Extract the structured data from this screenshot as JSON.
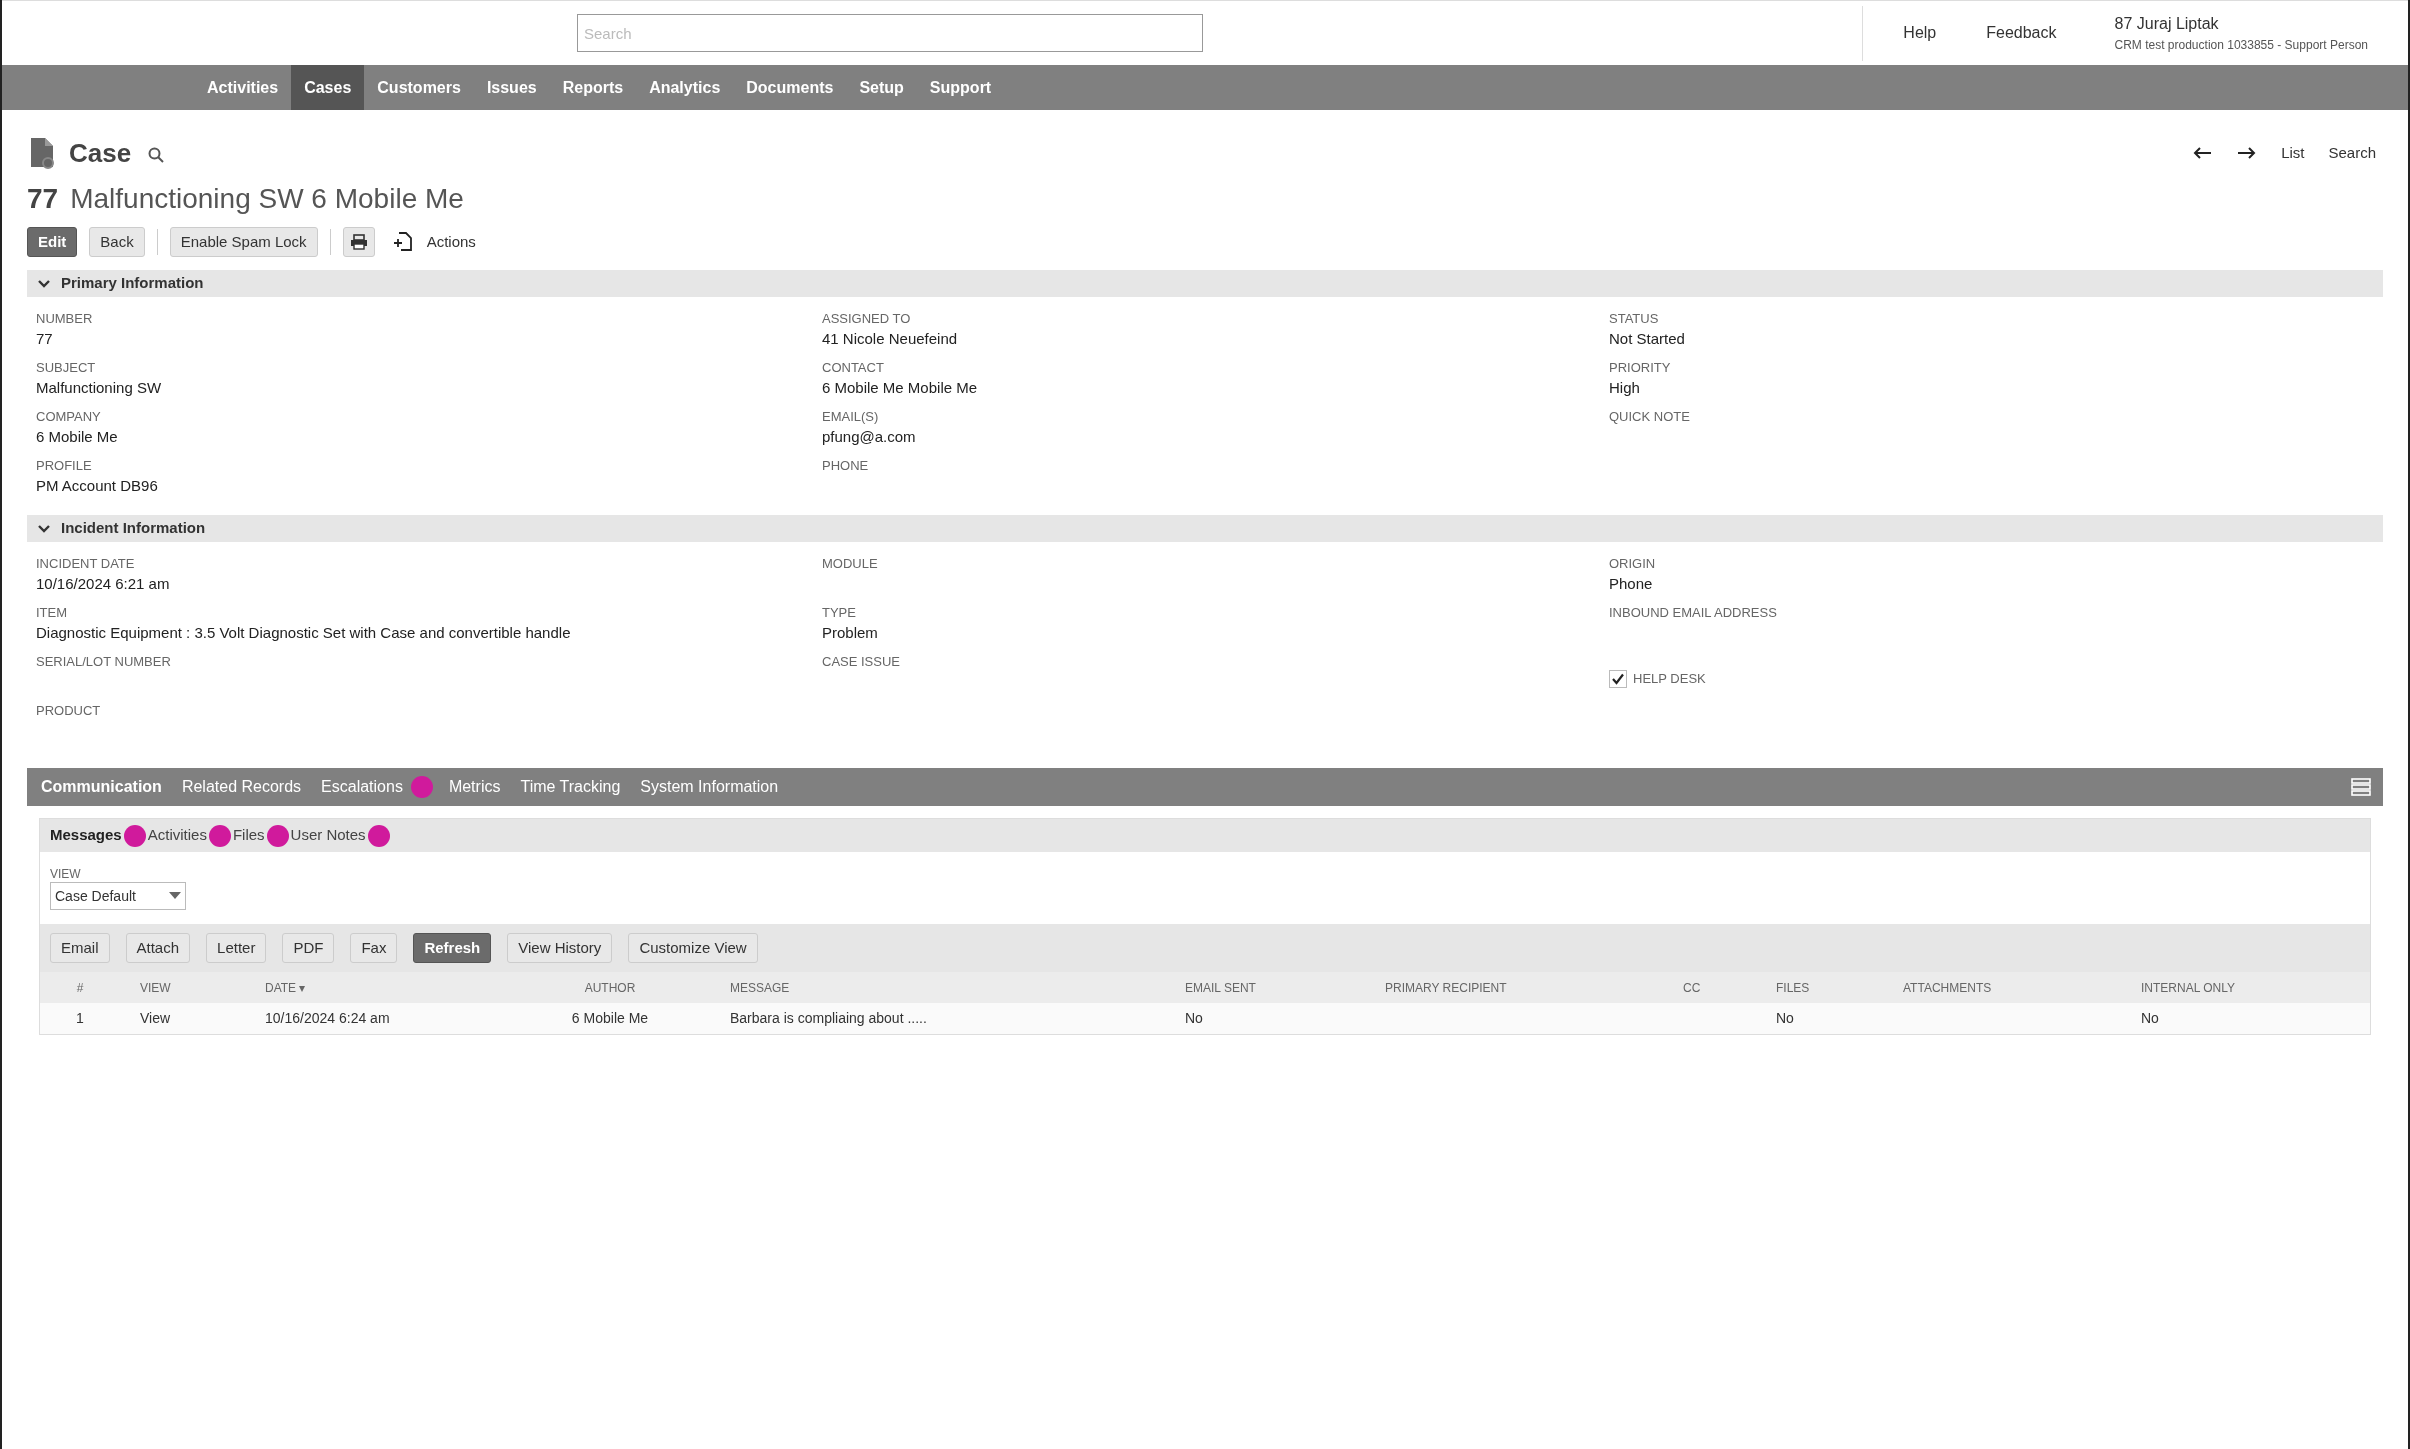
{
  "top_bar": {
    "search": {
      "placeholder": "Search"
    },
    "links": [
      "Help",
      "Feedback"
    ],
    "user": {
      "name": "87 Juraj Liptak",
      "subtitle": "CRM test production 1033855 - Support Person"
    }
  },
  "nav": [
    {
      "label": "Activities",
      "selected": false
    },
    {
      "label": "Cases",
      "selected": true
    },
    {
      "label": "Customers",
      "selected": false
    },
    {
      "label": "Issues",
      "selected": false
    },
    {
      "label": "Reports",
      "selected": false
    },
    {
      "label": "Analytics",
      "selected": false
    },
    {
      "label": "Documents",
      "selected": false
    },
    {
      "label": "Setup",
      "selected": false
    },
    {
      "label": "Support",
      "selected": false
    }
  ],
  "record": {
    "type": "Case",
    "number": "77",
    "title": "Malfunctioning SW 6 Mobile Me",
    "pager": [
      "List",
      "Search"
    ]
  },
  "toolbar": {
    "buttons": [
      {
        "label": "Edit",
        "primary": true
      },
      {
        "label": "Back",
        "primary": false
      },
      {
        "label": "Enable Spam Lock",
        "primary": false
      }
    ],
    "actions": "Actions"
  },
  "sections": [
    {
      "title": "Primary Information",
      "expanded": true,
      "columns": [
        [
          {
            "label": "NUMBER",
            "value": "77"
          },
          {
            "label": "SUBJECT",
            "value": "Malfunctioning SW"
          },
          {
            "label": "COMPANY",
            "value": "6 Mobile Me"
          },
          {
            "label": "PROFILE",
            "value": "PM Account DB96"
          }
        ],
        [
          {
            "label": "ASSIGNED TO",
            "value": "41 Nicole Neuefeind"
          },
          {
            "label": "CONTACT",
            "value": "6 Mobile Me Mobile Me"
          },
          {
            "label": "EMAIL(S)",
            "value": "pfung@a.com"
          },
          {
            "label": "PHONE"
          }
        ],
        [
          {
            "label": "STATUS",
            "value": "Not Started"
          },
          {
            "label": "PRIORITY",
            "value": "High"
          },
          {
            "label": "QUICK NOTE"
          }
        ]
      ]
    },
    {
      "title": "Incident Information",
      "expanded": true,
      "columns": [
        [
          {
            "label": "INCIDENT DATE",
            "value": "10/16/2024 6:21 am"
          },
          {
            "label": "ITEM",
            "value": "Diagnostic Equipment : 3.5 Volt Diagnostic Set with Case and convertible handle"
          },
          {
            "label": "SERIAL/LOT NUMBER"
          },
          {
            "label": "PRODUCT"
          }
        ],
        [
          {
            "label": "MODULE"
          },
          {
            "label": "TYPE",
            "value": "Problem"
          },
          {
            "label": "CASE ISSUE"
          }
        ],
        [
          {
            "label": "ORIGIN",
            "value": "Phone"
          },
          {
            "label": "INBOUND EMAIL ADDRESS"
          },
          {
            "kind": "checkbox",
            "label": "HELP DESK",
            "checked": true
          }
        ]
      ]
    }
  ],
  "tabs": [
    {
      "label": "Communication",
      "selected": true,
      "marker": false
    },
    {
      "label": "Related Records",
      "selected": false,
      "marker": false
    },
    {
      "label": "Escalations",
      "selected": false,
      "marker": true
    },
    {
      "label": "Metrics",
      "selected": false,
      "marker": false
    },
    {
      "label": "Time Tracking",
      "selected": false,
      "marker": false
    },
    {
      "label": "System Information",
      "selected": false,
      "marker": false
    }
  ],
  "subtabs": [
    {
      "label": "Messages",
      "selected": true,
      "marker": true
    },
    {
      "label": "Activities",
      "selected": false,
      "marker": true
    },
    {
      "label": "Files",
      "selected": false,
      "marker": true
    },
    {
      "label": "User Notes",
      "selected": false,
      "marker": true
    }
  ],
  "view": {
    "label": "VIEW",
    "value": "Case Default"
  },
  "message_buttons": [
    {
      "label": "Email",
      "primary": false
    },
    {
      "label": "Attach",
      "primary": false
    },
    {
      "label": "Letter",
      "primary": false
    },
    {
      "label": "PDF",
      "primary": false
    },
    {
      "label": "Fax",
      "primary": false
    },
    {
      "label": "Refresh",
      "primary": true
    },
    {
      "label": "View History",
      "primary": false
    },
    {
      "label": "Customize View",
      "primary": false
    }
  ],
  "table": {
    "columns": [
      "#",
      "VIEW",
      "DATE ▾",
      "AUTHOR",
      "MESSAGE",
      "EMAIL SENT",
      "PRIMARY RECIPIENT",
      "CC",
      "FILES",
      "ATTACHMENTS",
      "INTERNAL ONLY"
    ],
    "rows": [
      [
        "1",
        "View",
        "10/16/2024 6:24 am",
        "6 Mobile Me",
        "Barbara is compliaing about .....",
        "No",
        "",
        "",
        "No",
        "",
        "No"
      ]
    ]
  }
}
